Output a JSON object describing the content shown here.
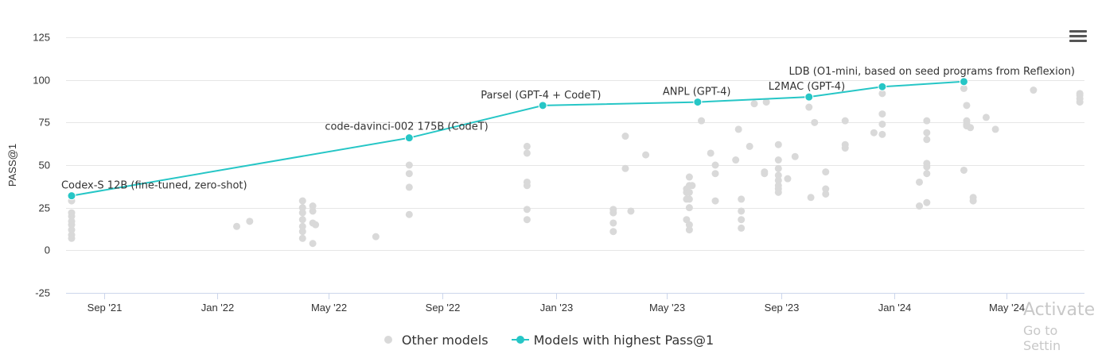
{
  "chart_data": {
    "type": "scatter",
    "title": "",
    "xlabel": "",
    "ylabel": "PASS@1",
    "ylim": [
      -25,
      125
    ],
    "yticks": [
      -25,
      0,
      25,
      50,
      75,
      100,
      125
    ],
    "xlim": [
      "2021-07-22",
      "2024-07-24"
    ],
    "xticks": [
      {
        "date": "2021-09-01",
        "label": "Sep '21"
      },
      {
        "date": "2022-01-01",
        "label": "Jan '22"
      },
      {
        "date": "2022-05-01",
        "label": "May '22"
      },
      {
        "date": "2022-09-01",
        "label": "Sep '22"
      },
      {
        "date": "2023-01-01",
        "label": "Jan '23"
      },
      {
        "date": "2023-05-01",
        "label": "May '23"
      },
      {
        "date": "2023-09-01",
        "label": "Sep '23"
      },
      {
        "date": "2024-01-01",
        "label": "Jan '24"
      },
      {
        "date": "2024-05-01",
        "label": "May '24"
      }
    ],
    "grid": true,
    "legend_position": "bottom-center",
    "series": [
      {
        "name": "Other models",
        "color": "#d9d9d9",
        "points": [
          [
            "2021-07-28",
            7
          ],
          [
            "2021-07-28",
            9
          ],
          [
            "2021-07-28",
            12
          ],
          [
            "2021-07-28",
            15
          ],
          [
            "2021-07-28",
            17
          ],
          [
            "2021-07-28",
            20
          ],
          [
            "2021-07-28",
            22
          ],
          [
            "2021-07-28",
            29
          ],
          [
            "2022-01-22",
            14
          ],
          [
            "2022-02-05",
            17
          ],
          [
            "2022-04-03",
            7
          ],
          [
            "2022-04-03",
            11
          ],
          [
            "2022-04-03",
            14
          ],
          [
            "2022-04-03",
            18
          ],
          [
            "2022-04-03",
            22
          ],
          [
            "2022-04-03",
            25
          ],
          [
            "2022-04-03",
            29
          ],
          [
            "2022-04-14",
            4
          ],
          [
            "2022-04-14",
            16
          ],
          [
            "2022-04-14",
            23
          ],
          [
            "2022-04-14",
            26
          ],
          [
            "2022-04-17",
            15
          ],
          [
            "2022-06-21",
            8
          ],
          [
            "2022-07-27",
            21
          ],
          [
            "2022-07-27",
            37
          ],
          [
            "2022-07-27",
            45
          ],
          [
            "2022-07-27",
            50
          ],
          [
            "2022-12-01",
            18
          ],
          [
            "2022-12-01",
            24
          ],
          [
            "2022-12-01",
            38
          ],
          [
            "2022-12-01",
            40
          ],
          [
            "2022-12-01",
            57
          ],
          [
            "2022-12-01",
            61
          ],
          [
            "2023-03-04",
            11
          ],
          [
            "2023-03-04",
            16
          ],
          [
            "2023-03-04",
            22
          ],
          [
            "2023-03-04",
            24
          ],
          [
            "2023-03-17",
            48
          ],
          [
            "2023-03-17",
            67
          ],
          [
            "2023-03-23",
            23
          ],
          [
            "2023-04-08",
            56
          ],
          [
            "2023-05-22",
            18
          ],
          [
            "2023-05-22",
            30
          ],
          [
            "2023-05-22",
            34
          ],
          [
            "2023-05-22",
            36
          ],
          [
            "2023-05-25",
            12
          ],
          [
            "2023-05-25",
            15
          ],
          [
            "2023-05-25",
            25
          ],
          [
            "2023-05-25",
            30
          ],
          [
            "2023-05-25",
            34
          ],
          [
            "2023-05-25",
            38
          ],
          [
            "2023-05-25",
            43
          ],
          [
            "2023-05-28",
            38
          ],
          [
            "2023-06-07",
            76
          ],
          [
            "2023-06-17",
            57
          ],
          [
            "2023-06-22",
            29
          ],
          [
            "2023-06-22",
            45
          ],
          [
            "2023-06-22",
            50
          ],
          [
            "2023-07-14",
            53
          ],
          [
            "2023-07-17",
            71
          ],
          [
            "2023-07-20",
            13
          ],
          [
            "2023-07-20",
            18
          ],
          [
            "2023-07-20",
            23
          ],
          [
            "2023-07-20",
            30
          ],
          [
            "2023-07-29",
            61
          ],
          [
            "2023-08-03",
            86
          ],
          [
            "2023-08-14",
            46
          ],
          [
            "2023-08-14",
            45
          ],
          [
            "2023-08-16",
            87
          ],
          [
            "2023-08-29",
            34
          ],
          [
            "2023-08-29",
            36
          ],
          [
            "2023-08-29",
            38
          ],
          [
            "2023-08-29",
            41
          ],
          [
            "2023-08-29",
            44
          ],
          [
            "2023-08-29",
            48
          ],
          [
            "2023-08-29",
            53
          ],
          [
            "2023-08-29",
            62
          ],
          [
            "2023-09-08",
            42
          ],
          [
            "2023-09-16",
            55
          ],
          [
            "2023-10-01",
            84
          ],
          [
            "2023-10-03",
            31
          ],
          [
            "2023-10-07",
            75
          ],
          [
            "2023-10-19",
            46
          ],
          [
            "2023-10-19",
            36
          ],
          [
            "2023-10-19",
            33
          ],
          [
            "2023-11-09",
            60
          ],
          [
            "2023-11-09",
            62
          ],
          [
            "2023-11-09",
            76
          ],
          [
            "2023-12-10",
            69
          ],
          [
            "2023-12-19",
            68
          ],
          [
            "2023-12-19",
            74
          ],
          [
            "2023-12-19",
            80
          ],
          [
            "2023-12-19",
            92
          ],
          [
            "2024-01-28",
            26
          ],
          [
            "2024-01-28",
            40
          ],
          [
            "2024-02-05",
            28
          ],
          [
            "2024-02-05",
            45
          ],
          [
            "2024-02-05",
            49
          ],
          [
            "2024-02-05",
            51
          ],
          [
            "2024-02-05",
            65
          ],
          [
            "2024-02-05",
            69
          ],
          [
            "2024-02-05",
            76
          ],
          [
            "2024-03-16",
            47
          ],
          [
            "2024-03-16",
            95
          ],
          [
            "2024-03-19",
            85
          ],
          [
            "2024-03-19",
            76
          ],
          [
            "2024-03-19",
            74
          ],
          [
            "2024-03-19",
            73
          ],
          [
            "2024-03-23",
            72
          ],
          [
            "2024-03-26",
            29
          ],
          [
            "2024-03-26",
            31
          ],
          [
            "2024-04-09",
            78
          ],
          [
            "2024-04-19",
            71
          ],
          [
            "2024-05-30",
            94
          ],
          [
            "2024-07-19",
            87
          ],
          [
            "2024-07-19",
            89
          ],
          [
            "2024-07-19",
            91
          ],
          [
            "2024-07-19",
            92
          ]
        ]
      },
      {
        "name": "Models with highest Pass@1",
        "color": "#26c6c6",
        "points": [
          {
            "date": "2021-07-28",
            "value": 32,
            "label": "Codex-S 12B (fine-tuned, zero-shot)"
          },
          {
            "date": "2022-07-27",
            "value": 66,
            "label": "code-davinci-002 175B (CodeT)"
          },
          {
            "date": "2022-12-18",
            "value": 85,
            "label": "Parsel (GPT-4 + CodeT)"
          },
          {
            "date": "2023-06-03",
            "value": 87,
            "label": "ANPL (GPT-4)"
          },
          {
            "date": "2023-10-01",
            "value": 90,
            "label": "L2MAC (GPT-4)"
          },
          {
            "date": "2023-12-19",
            "value": 96,
            "label": ""
          },
          {
            "date": "2024-03-16",
            "value": 99,
            "label": "LDB (O1-mini, based on seed programs from Reflexion)"
          }
        ]
      }
    ]
  },
  "legend": {
    "other_label": "Other models",
    "best_label": "Models with highest Pass@1"
  },
  "menu": {
    "icon": "hamburger-menu-icon"
  },
  "watermark": {
    "line1": "Activate",
    "line2": "Go to Settin"
  }
}
